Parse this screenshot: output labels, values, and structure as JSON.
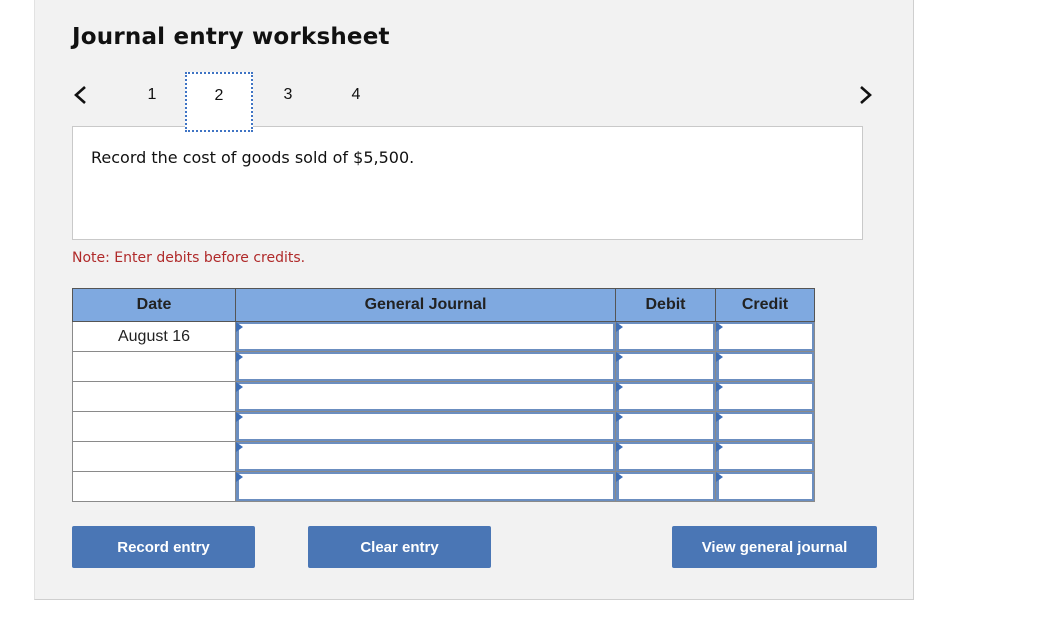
{
  "header": {
    "title": "Journal entry worksheet"
  },
  "pagination": {
    "prev_icon": "chevron-left-icon",
    "next_icon": "chevron-right-icon",
    "tabs": [
      {
        "label": "1",
        "active": false
      },
      {
        "label": "2",
        "active": true
      },
      {
        "label": "3",
        "active": false
      },
      {
        "label": "4",
        "active": false
      }
    ]
  },
  "prompt": {
    "text": "Record the cost of goods sold of $5,500."
  },
  "note": {
    "text": "Note: Enter debits before credits."
  },
  "table": {
    "columns": [
      "Date",
      "General Journal",
      "Debit",
      "Credit"
    ],
    "rows": [
      {
        "date": "August 16",
        "account": "",
        "debit": "",
        "credit": ""
      },
      {
        "date": "",
        "account": "",
        "debit": "",
        "credit": ""
      },
      {
        "date": "",
        "account": "",
        "debit": "",
        "credit": ""
      },
      {
        "date": "",
        "account": "",
        "debit": "",
        "credit": ""
      },
      {
        "date": "",
        "account": "",
        "debit": "",
        "credit": ""
      },
      {
        "date": "",
        "account": "",
        "debit": "",
        "credit": ""
      }
    ]
  },
  "buttons": {
    "record": "Record entry",
    "clear": "Clear entry",
    "view": "View general journal"
  },
  "colors": {
    "accent": "#4a76b5",
    "header_bg": "#7fa9e0",
    "note": "#b02a2a"
  }
}
